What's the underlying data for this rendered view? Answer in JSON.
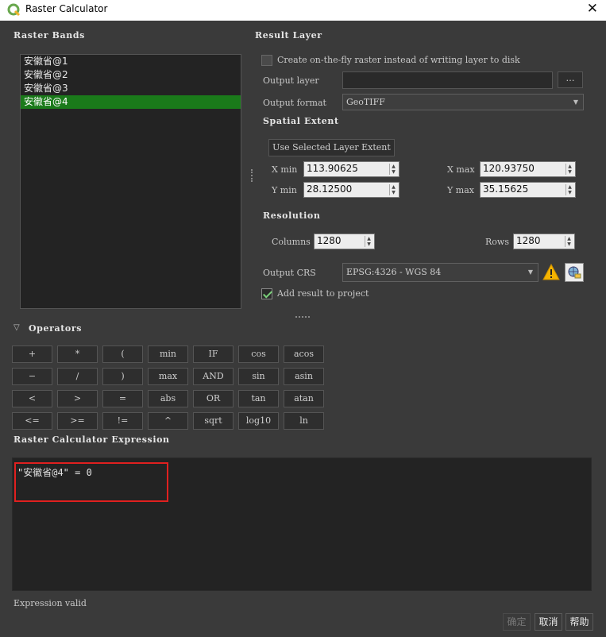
{
  "window": {
    "title": "Raster Calculator",
    "close_glyph": "✕"
  },
  "raster_bands": {
    "header": "Raster Bands",
    "items": [
      "安徽省@1",
      "安徽省@2",
      "安徽省@3",
      "安徽省@4"
    ],
    "selected_index": 3
  },
  "result_layer": {
    "header": "Result Layer",
    "on_the_fly_label": "Create on-the-fly raster instead of writing layer to disk",
    "on_the_fly_checked": false,
    "output_layer_label": "Output layer",
    "output_layer_value": "",
    "browse_label": "…",
    "output_format_label": "Output format",
    "output_format_value": "GeoTIFF"
  },
  "spatial_extent": {
    "header": "Spatial Extent",
    "use_selected_label": "Use Selected Layer Extent",
    "xmin_label": "X min",
    "xmin_value": "113.90625",
    "xmax_label": "X max",
    "xmax_value": "120.93750",
    "ymin_label": "Y min",
    "ymin_value": "28.12500",
    "ymax_label": "Y max",
    "ymax_value": "35.15625"
  },
  "resolution": {
    "header": "Resolution",
    "columns_label": "Columns",
    "columns_value": "1280",
    "rows_label": "Rows",
    "rows_value": "1280"
  },
  "output_crs": {
    "label": "Output CRS",
    "value": "EPSG:4326 - WGS 84",
    "add_to_project_label": "Add result to project",
    "add_to_project_checked": true
  },
  "operators": {
    "header": "Operators",
    "rows": [
      [
        "+",
        "*",
        "(",
        "min",
        "IF",
        "cos",
        "acos"
      ],
      [
        "−",
        "/",
        ")",
        "max",
        "AND",
        "sin",
        "asin"
      ],
      [
        "<",
        ">",
        "=",
        "abs",
        "OR",
        "tan",
        "atan"
      ],
      [
        "<=",
        ">=",
        "!=",
        "^",
        "sqrt",
        "log10",
        "ln"
      ]
    ]
  },
  "expression": {
    "header": "Raster Calculator Expression",
    "text": "\"安徽省@4\" = 0",
    "status": "Expression valid"
  },
  "buttons": {
    "ok": "确定",
    "cancel": "取消",
    "help": "帮助"
  },
  "colors": {
    "selection": "#1a7a1a",
    "highlight_box": "#e0201f",
    "background": "#3a3a3a"
  }
}
